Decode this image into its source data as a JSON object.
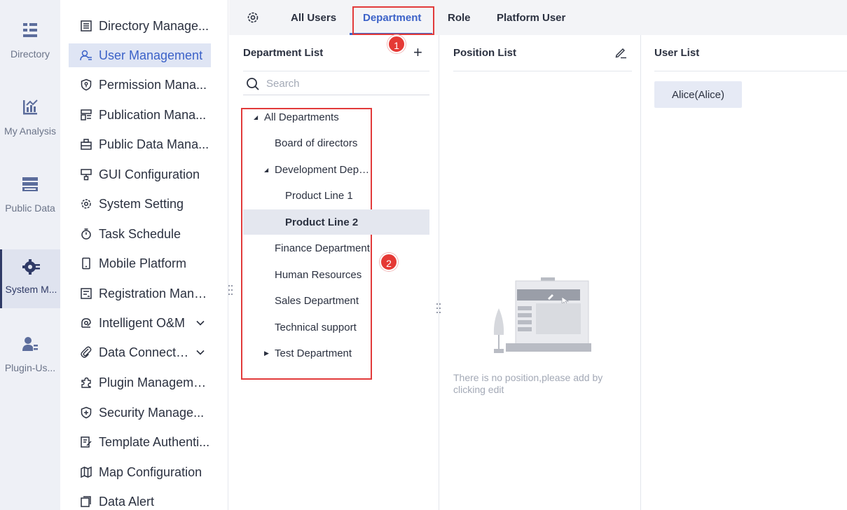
{
  "rail": {
    "items": [
      {
        "label": "Directory",
        "icon": "directory-icon"
      },
      {
        "label": "My Analysis",
        "icon": "analysis-icon"
      },
      {
        "label": "Public Data",
        "icon": "public-data-icon"
      },
      {
        "label": "System M...",
        "icon": "system-management-icon"
      },
      {
        "label": "Plugin-Us...",
        "icon": "plugin-user-icon"
      }
    ]
  },
  "menu": {
    "items": [
      {
        "label": "Directory Manage...",
        "icon": "directory-management-icon"
      },
      {
        "label": "User Management",
        "icon": "user-management-icon"
      },
      {
        "label": "Permission Mana...",
        "icon": "permission-icon"
      },
      {
        "label": "Publication Mana...",
        "icon": "publication-icon"
      },
      {
        "label": "Public Data Mana...",
        "icon": "public-data-management-icon"
      },
      {
        "label": "GUI Configuration",
        "icon": "gui-configuration-icon"
      },
      {
        "label": "System Setting",
        "icon": "system-setting-icon"
      },
      {
        "label": "Task Schedule",
        "icon": "task-schedule-icon"
      },
      {
        "label": "Mobile Platform",
        "icon": "mobile-icon"
      },
      {
        "label": "Registration Mana...",
        "icon": "registration-icon"
      },
      {
        "label": "Intelligent O&M",
        "icon": "intelligent-om-icon"
      },
      {
        "label": "Data Connection",
        "icon": "data-connection-icon"
      },
      {
        "label": "Plugin Management",
        "icon": "plugin-icon"
      },
      {
        "label": "Security Manage...",
        "icon": "security-icon"
      },
      {
        "label": "Template Authenti...",
        "icon": "template-auth-icon"
      },
      {
        "label": "Map Configuration",
        "icon": "map-icon"
      },
      {
        "label": "Data Alert",
        "icon": "data-alert-icon"
      }
    ]
  },
  "tabs": {
    "items": [
      "All Users",
      "Department",
      "Role",
      "Platform User"
    ],
    "active": "Department"
  },
  "badges": {
    "first": "1",
    "second": "2"
  },
  "department_panel": {
    "title": "Department List",
    "add_symbol": "+",
    "search_placeholder": "Search",
    "tree": [
      {
        "label": "All Departments",
        "caret": "◢"
      },
      {
        "label": "Board of directors",
        "caret": ""
      },
      {
        "label": "Development Depa...",
        "caret": "◢"
      },
      {
        "label": "Product Line 1",
        "caret": ""
      },
      {
        "label": "Product Line 2",
        "caret": ""
      },
      {
        "label": "Finance Department",
        "caret": ""
      },
      {
        "label": "Human Resources",
        "caret": ""
      },
      {
        "label": "Sales Department",
        "caret": ""
      },
      {
        "label": "Technical support",
        "caret": ""
      },
      {
        "label": "Test Department",
        "caret": "▶"
      }
    ]
  },
  "position_panel": {
    "title": "Position List",
    "empty_text": "There is no position,please add by clicking edit"
  },
  "user_panel": {
    "title": "User List",
    "users": [
      "Alice(Alice)"
    ]
  },
  "colors": {
    "accent": "#3c62c8",
    "highlight_red": "#e23b3b",
    "rail_bg": "#eef0f6"
  }
}
